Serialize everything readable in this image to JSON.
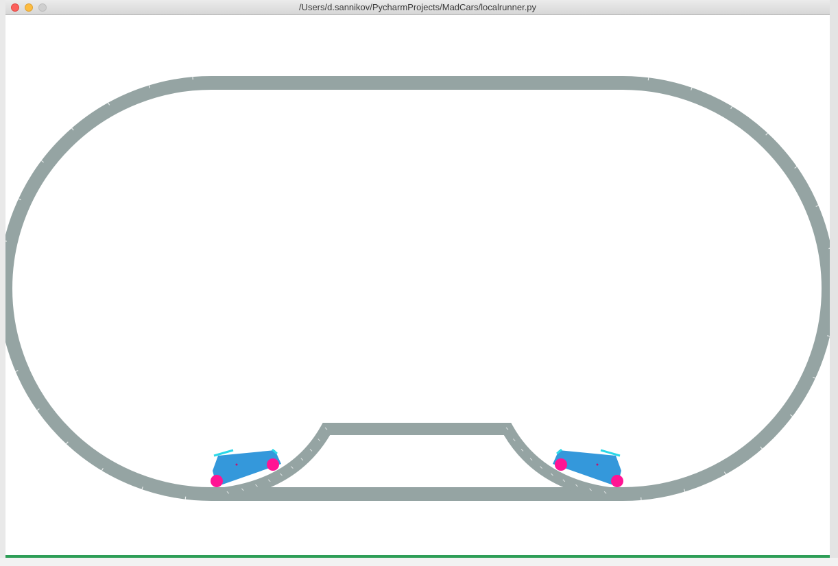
{
  "window": {
    "title": "/Users/d.sannikov/PycharmProjects/MadCars/localrunner.py"
  },
  "colors": {
    "track": "#95a4a3",
    "car_body": "#3498db",
    "wheel": "#ff1493",
    "bumper": "#2ad8e8",
    "status_bar": "#2e9e57"
  },
  "icons": {
    "close": "red-circle",
    "minimize": "yellow-circle",
    "maximize": "gray-circle"
  },
  "scene": {
    "cars": [
      {
        "name": "car-left",
        "facing": "right"
      },
      {
        "name": "car-right",
        "facing": "left"
      }
    ]
  }
}
